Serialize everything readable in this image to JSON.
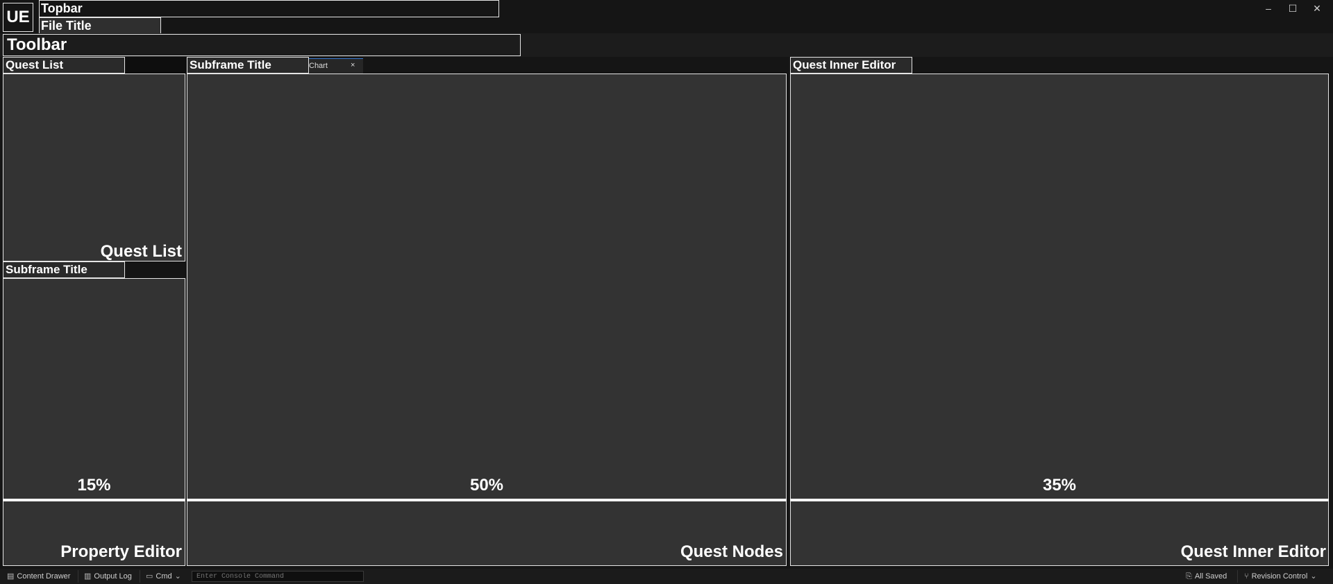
{
  "app": {
    "logo": "UE",
    "topbar": "Topbar",
    "file_title": "File Title",
    "window_controls": {
      "minimize": "–",
      "maximize": "☐",
      "close": "✕"
    }
  },
  "toolbar": {
    "label": "Toolbar"
  },
  "panels": {
    "quest_list": {
      "tab_title": "Quest List",
      "label": "Quest List"
    },
    "property_editor": {
      "tab_title": "Subframe Title",
      "label": "Property Editor",
      "percent": "15%"
    },
    "quest_nodes": {
      "tab_title": "Subframe Title",
      "label": "Quest Nodes",
      "percent": "50%",
      "extra_tab": {
        "label": "Chart",
        "close": "×"
      }
    },
    "quest_inner_editor": {
      "tab_title": "Quest Inner Editor",
      "label": "Quest Inner Editor",
      "percent": "35%"
    }
  },
  "statusbar": {
    "content_drawer": "Content Drawer",
    "output_log": "Output Log",
    "cmd": "Cmd",
    "console_placeholder": "Enter Console Command",
    "all_saved": "All Saved",
    "revision_control": "Revision Control"
  },
  "icons": {
    "content_drawer": "drawer-icon",
    "output_log": "log-icon",
    "cmd": "terminal-icon",
    "all_saved": "save-icon",
    "revision_control": "branch-icon",
    "chevron": "chevron-down-icon"
  }
}
